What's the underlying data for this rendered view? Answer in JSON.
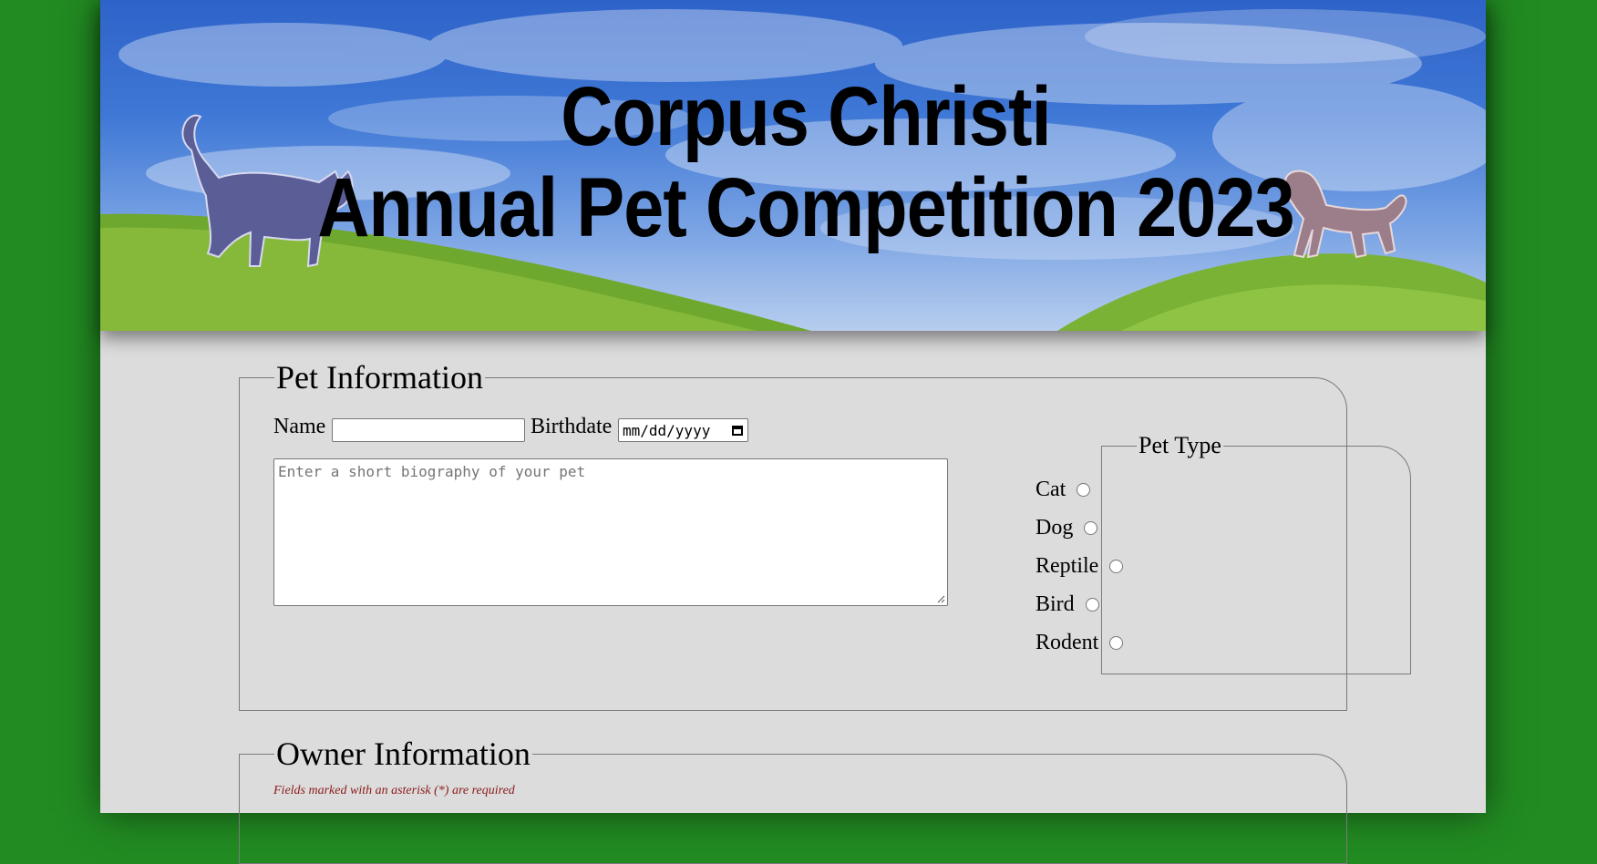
{
  "banner": {
    "title_line1": "Corpus Christi",
    "title_line2": "Annual Pet Competition 2023"
  },
  "pet_information": {
    "legend": "Pet Information",
    "name_label": "Name",
    "name_value": "",
    "birthdate_label": "Birthdate",
    "birthdate_value": "mm/dd/yyyy",
    "bio_placeholder": "Enter a short biography of your pet",
    "pet_type": {
      "legend": "Pet Type",
      "options": [
        "Cat",
        "Dog",
        "Reptile",
        "Bird",
        "Rodent"
      ]
    }
  },
  "owner_information": {
    "legend": "Owner Information",
    "required_note": "Fields marked with an asterisk (*) are required"
  },
  "colors": {
    "background": "#228b22",
    "panel": "#dcdcdc",
    "note": "#8b1a1a"
  }
}
